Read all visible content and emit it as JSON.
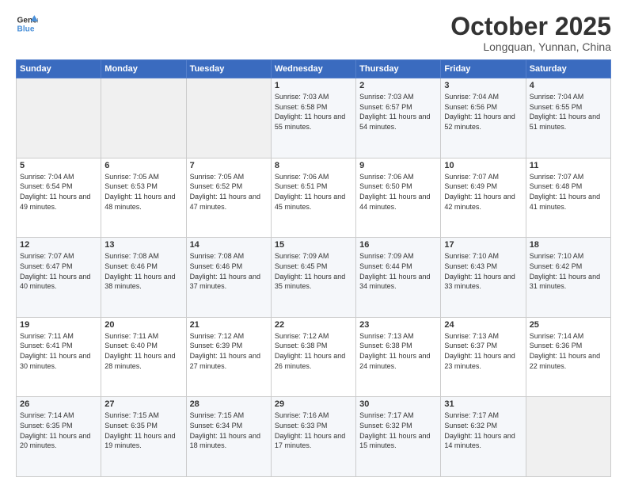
{
  "logo": {
    "line1": "General",
    "line2": "Blue"
  },
  "header": {
    "month": "October 2025",
    "location": "Longquan, Yunnan, China"
  },
  "weekdays": [
    "Sunday",
    "Monday",
    "Tuesday",
    "Wednesday",
    "Thursday",
    "Friday",
    "Saturday"
  ],
  "weeks": [
    [
      {
        "day": "",
        "info": ""
      },
      {
        "day": "",
        "info": ""
      },
      {
        "day": "",
        "info": ""
      },
      {
        "day": "1",
        "sunrise": "7:03 AM",
        "sunset": "6:58 PM",
        "daylight": "11 hours and 55 minutes."
      },
      {
        "day": "2",
        "sunrise": "7:03 AM",
        "sunset": "6:57 PM",
        "daylight": "11 hours and 54 minutes."
      },
      {
        "day": "3",
        "sunrise": "7:04 AM",
        "sunset": "6:56 PM",
        "daylight": "11 hours and 52 minutes."
      },
      {
        "day": "4",
        "sunrise": "7:04 AM",
        "sunset": "6:55 PM",
        "daylight": "11 hours and 51 minutes."
      }
    ],
    [
      {
        "day": "5",
        "sunrise": "7:04 AM",
        "sunset": "6:54 PM",
        "daylight": "11 hours and 49 minutes."
      },
      {
        "day": "6",
        "sunrise": "7:05 AM",
        "sunset": "6:53 PM",
        "daylight": "11 hours and 48 minutes."
      },
      {
        "day": "7",
        "sunrise": "7:05 AM",
        "sunset": "6:52 PM",
        "daylight": "11 hours and 47 minutes."
      },
      {
        "day": "8",
        "sunrise": "7:06 AM",
        "sunset": "6:51 PM",
        "daylight": "11 hours and 45 minutes."
      },
      {
        "day": "9",
        "sunrise": "7:06 AM",
        "sunset": "6:50 PM",
        "daylight": "11 hours and 44 minutes."
      },
      {
        "day": "10",
        "sunrise": "7:07 AM",
        "sunset": "6:49 PM",
        "daylight": "11 hours and 42 minutes."
      },
      {
        "day": "11",
        "sunrise": "7:07 AM",
        "sunset": "6:48 PM",
        "daylight": "11 hours and 41 minutes."
      }
    ],
    [
      {
        "day": "12",
        "sunrise": "7:07 AM",
        "sunset": "6:47 PM",
        "daylight": "11 hours and 40 minutes."
      },
      {
        "day": "13",
        "sunrise": "7:08 AM",
        "sunset": "6:46 PM",
        "daylight": "11 hours and 38 minutes."
      },
      {
        "day": "14",
        "sunrise": "7:08 AM",
        "sunset": "6:46 PM",
        "daylight": "11 hours and 37 minutes."
      },
      {
        "day": "15",
        "sunrise": "7:09 AM",
        "sunset": "6:45 PM",
        "daylight": "11 hours and 35 minutes."
      },
      {
        "day": "16",
        "sunrise": "7:09 AM",
        "sunset": "6:44 PM",
        "daylight": "11 hours and 34 minutes."
      },
      {
        "day": "17",
        "sunrise": "7:10 AM",
        "sunset": "6:43 PM",
        "daylight": "11 hours and 33 minutes."
      },
      {
        "day": "18",
        "sunrise": "7:10 AM",
        "sunset": "6:42 PM",
        "daylight": "11 hours and 31 minutes."
      }
    ],
    [
      {
        "day": "19",
        "sunrise": "7:11 AM",
        "sunset": "6:41 PM",
        "daylight": "11 hours and 30 minutes."
      },
      {
        "day": "20",
        "sunrise": "7:11 AM",
        "sunset": "6:40 PM",
        "daylight": "11 hours and 28 minutes."
      },
      {
        "day": "21",
        "sunrise": "7:12 AM",
        "sunset": "6:39 PM",
        "daylight": "11 hours and 27 minutes."
      },
      {
        "day": "22",
        "sunrise": "7:12 AM",
        "sunset": "6:38 PM",
        "daylight": "11 hours and 26 minutes."
      },
      {
        "day": "23",
        "sunrise": "7:13 AM",
        "sunset": "6:38 PM",
        "daylight": "11 hours and 24 minutes."
      },
      {
        "day": "24",
        "sunrise": "7:13 AM",
        "sunset": "6:37 PM",
        "daylight": "11 hours and 23 minutes."
      },
      {
        "day": "25",
        "sunrise": "7:14 AM",
        "sunset": "6:36 PM",
        "daylight": "11 hours and 22 minutes."
      }
    ],
    [
      {
        "day": "26",
        "sunrise": "7:14 AM",
        "sunset": "6:35 PM",
        "daylight": "11 hours and 20 minutes."
      },
      {
        "day": "27",
        "sunrise": "7:15 AM",
        "sunset": "6:35 PM",
        "daylight": "11 hours and 19 minutes."
      },
      {
        "day": "28",
        "sunrise": "7:15 AM",
        "sunset": "6:34 PM",
        "daylight": "11 hours and 18 minutes."
      },
      {
        "day": "29",
        "sunrise": "7:16 AM",
        "sunset": "6:33 PM",
        "daylight": "11 hours and 17 minutes."
      },
      {
        "day": "30",
        "sunrise": "7:17 AM",
        "sunset": "6:32 PM",
        "daylight": "11 hours and 15 minutes."
      },
      {
        "day": "31",
        "sunrise": "7:17 AM",
        "sunset": "6:32 PM",
        "daylight": "11 hours and 14 minutes."
      },
      {
        "day": "",
        "info": ""
      }
    ]
  ]
}
